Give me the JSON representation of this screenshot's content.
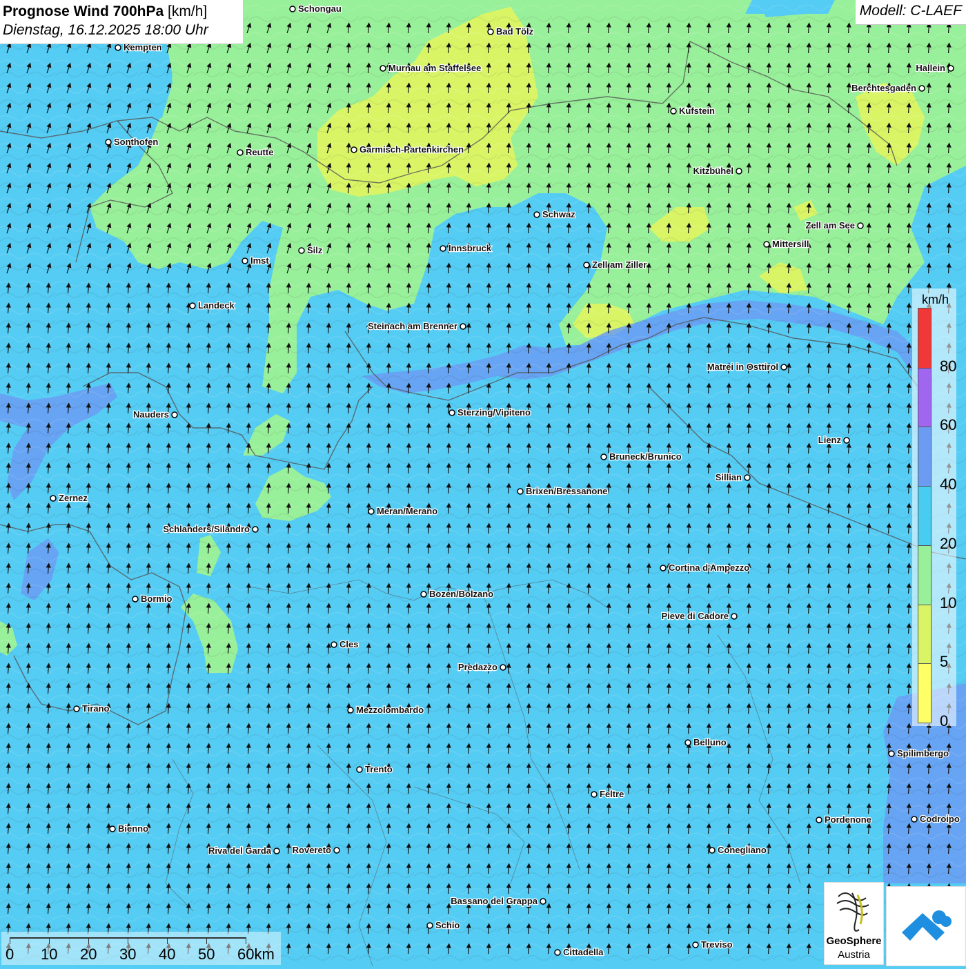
{
  "header": {
    "title_bold": "Prognose Wind 700hPa",
    "title_unit": " [km/h]",
    "subtitle": "Dienstag, 16.12.2025 18:00 Uhr"
  },
  "model": {
    "label": "Modell: C-LAEF"
  },
  "legend": {
    "unit": "km/h",
    "classes": [
      {
        "from": 0,
        "to": 5,
        "color": "#ffff66"
      },
      {
        "from": 5,
        "to": 10,
        "color": "#d9f566"
      },
      {
        "from": 10,
        "to": 20,
        "color": "#99f09a"
      },
      {
        "from": 20,
        "to": 40,
        "color": "#48ccf2"
      },
      {
        "from": 40,
        "to": 60,
        "color": "#6b9cf2"
      },
      {
        "from": 60,
        "to": 80,
        "color": "#a066f0"
      },
      {
        "from": 80,
        "to": 100,
        "color": "#f03838"
      }
    ],
    "labels": [
      "80",
      "60",
      "40",
      "20",
      "10",
      "5",
      "0"
    ]
  },
  "scalebar": {
    "labels": [
      "0",
      "10",
      "20",
      "30",
      "40",
      "50",
      "60km"
    ]
  },
  "logos": {
    "geosphere_name": "GeoSphere",
    "geosphere_sub": "Austria"
  },
  "wind": {
    "prevailing_direction": "from south (arrows pointing north)",
    "arrow_icon": "wind-arrow-icon"
  },
  "cities": [
    "Schongau",
    "Bad Tölz",
    "Kempten",
    "Murnau am Staffelsee",
    "Hallein",
    "Berchtesgaden",
    "Kufstein",
    "Sonthofen",
    "Reutte",
    "Garmisch-Partenkirchen",
    "Kitzbühel",
    "Schwaz",
    "Zell am See",
    "Mittersill",
    "Innsbruck",
    "Silz",
    "Imst",
    "Zell am Ziller",
    "Landeck",
    "Steinach am Brenner",
    "Matrei in Osttirol",
    "Nauders",
    "Sterzing/Vipiteno",
    "Lienz",
    "Bruneck/Brunico",
    "Sillian",
    "Zernez",
    "Brixen/Bressanone",
    "Meran/Merano",
    "Schlanders/Silandro",
    "Cortina d'Ampezzo",
    "Bozen/Bolzano",
    "Bormio",
    "Pieve di Cadore",
    "Cles",
    "Predazzo",
    "Tirano",
    "Mezzolombardo",
    "Belluno",
    "Spilimbergo",
    "Trento",
    "Feltre",
    "Pordenone",
    "Codroipo",
    "Bienno",
    "Riva del Garda",
    "Rovereto",
    "Conegliano",
    "Bassano del Grappa",
    "Schio",
    "Treviso",
    "Cittadella"
  ]
}
